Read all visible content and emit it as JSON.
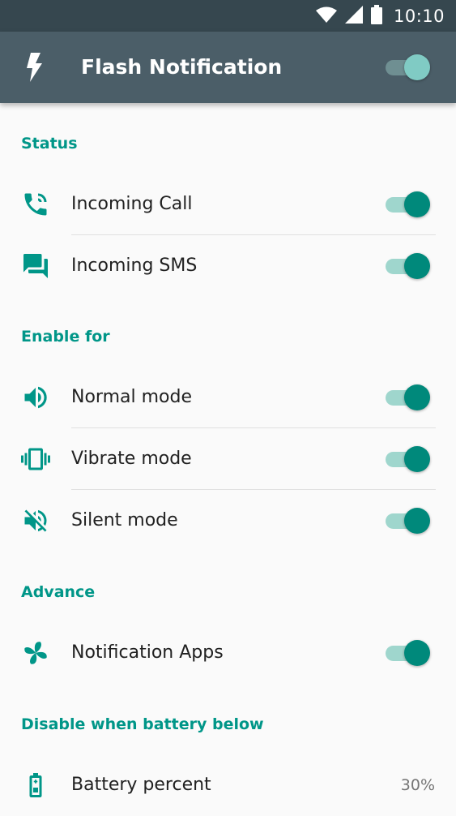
{
  "status_bar": {
    "time": "10:10",
    "icons": [
      "wifi-icon",
      "signal-icon",
      "battery-icon"
    ]
  },
  "app_bar": {
    "icon": "flash-icon",
    "title": "Flash Notification",
    "master_switch_on": true
  },
  "colors": {
    "accent": "#009688",
    "app_bar": "#4b5e68",
    "status_bar": "#36474f",
    "switch_thumb": "#00897b",
    "switch_track": "#9fd6cd"
  },
  "sections": {
    "status": {
      "header": "Status",
      "items": [
        {
          "label": "Incoming Call",
          "icon": "phone-ringing-icon",
          "on": true
        },
        {
          "label": "Incoming SMS",
          "icon": "sms-icon",
          "on": true
        }
      ]
    },
    "enable_for": {
      "header": "Enable for",
      "items": [
        {
          "label": "Normal mode",
          "icon": "volume-icon",
          "on": true
        },
        {
          "label": "Vibrate mode",
          "icon": "vibrate-icon",
          "on": true
        },
        {
          "label": "Silent mode",
          "icon": "volume-off-icon",
          "on": true
        }
      ]
    },
    "advance": {
      "header": "Advance",
      "items": [
        {
          "label": "Notification Apps",
          "icon": "pinwheel-icon",
          "on": true
        }
      ]
    },
    "battery": {
      "header": "Disable when battery below",
      "items": [
        {
          "label": "Battery percent",
          "icon": "battery-alert-icon",
          "value": "30%"
        }
      ]
    }
  }
}
